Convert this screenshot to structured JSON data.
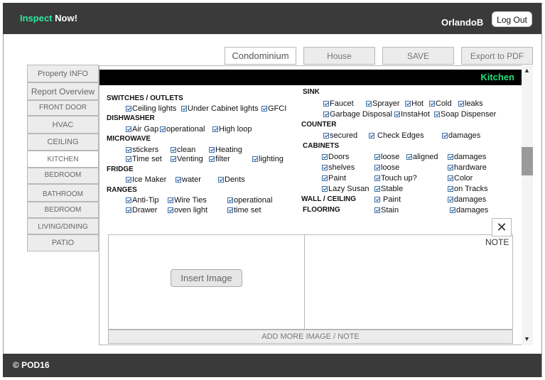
{
  "header": {
    "brand_a": "Inspect",
    "brand_b": " Now!",
    "user": "OrlandoB",
    "logout": "Log Out"
  },
  "top_buttons": {
    "condo": "Condominium",
    "house": "House",
    "save": "SAVE",
    "export": "Export to PDF"
  },
  "sidebar": [
    "Property INFO",
    "Report Overview",
    "FRONT DOOR",
    "HVAC",
    "CEILING",
    "KITCHEN",
    "BEDROOM",
    "BATHROOM",
    "BEDROOM",
    "LIVING/DINING",
    "PATIO"
  ],
  "section_title": "Kitchen",
  "left": {
    "switches": "SWITCHES / OUTLETS",
    "ceiling_lights": "Ceiling lights",
    "under_cabinet": "Under Cabinet lights",
    "gfci": "GFCI",
    "dishwasher": "DISHWASHER",
    "air_gap": "Air Gap",
    "operational": "operational",
    "high_loop": "High loop",
    "microwave": "MICROWAVE",
    "stickers": "stickers",
    "clean": "clean",
    "heating": "Heating",
    "time_set": "Time set",
    "venting": "Venting",
    "filter": "filter",
    "lighting": "lighting",
    "fridge": "FRIDGE",
    "ice_maker": "Ice Maker",
    "water": "water",
    "dents": "Dents",
    "ranges": "RANGES",
    "anti_tip": "Anti-Tip",
    "wire_ties": "Wire Ties",
    "ranges_operational": "operational",
    "drawer": "Drawer",
    "oven_light": "oven light",
    "ranges_time_set": "time set"
  },
  "right": {
    "sink": "SINK",
    "faucet": "Faucet",
    "sprayer": "Sprayer",
    "hot": "Hot",
    "cold": "Cold",
    "leaks": "leaks",
    "garbage": "Garbage Disposal",
    "instahot": "InstaHot",
    "soap": "Soap Dispenser",
    "counter": "COUNTER",
    "secured": "secured",
    "check_edges": " Check Edges",
    "counter_damages": "damages",
    "cabinets": "CABINETS",
    "doors": "Doors",
    "loose": "loose",
    "aligned": "aligned",
    "cab_damages": "damages",
    "shelves": "shelves",
    "loose2": "loose",
    "hardware": "hardware",
    "paint": "Paint",
    "touch_up": "Touch up?",
    "color": "Color",
    "lazy_susan": "Lazy Susan",
    "stable": "Stable",
    "on_tracks": "on Tracks",
    "wall_ceiling": "WALL / CEILING",
    "wall_paint": " Paint",
    "wall_damages": "damages",
    "flooring": "FLOORING",
    "stain": "Stain",
    "floor_damages": "damages"
  },
  "media": {
    "insert": "Insert Image",
    "note": "NOTE",
    "close": "✕",
    "add_more": "ADD MORE IMAGE / NOTE"
  },
  "footer": {
    "copyright": "© POD16"
  }
}
